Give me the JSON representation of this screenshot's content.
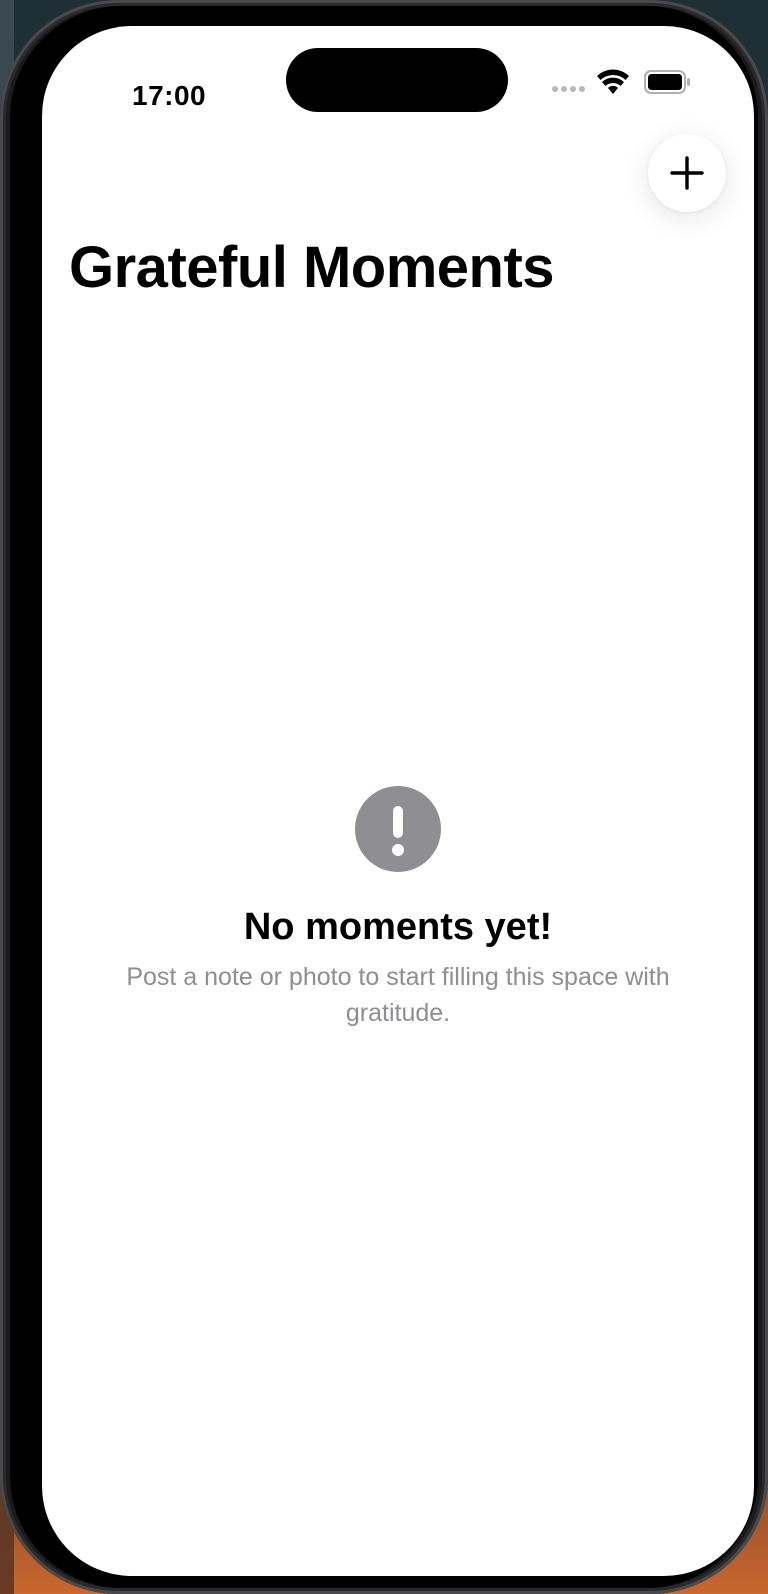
{
  "status_bar": {
    "time": "17:00",
    "signal_icon": "cellular-signal-icon",
    "wifi_icon": "wifi-icon",
    "battery_icon": "battery-icon"
  },
  "header": {
    "title": "Grateful Moments",
    "add_button_icon": "plus-icon"
  },
  "empty_state": {
    "icon": "exclamation-circle-icon",
    "title": "No moments yet!",
    "subtitle": "Post a note or photo to start filling this space with gratitude."
  },
  "colors": {
    "screen_background": "#ffffff",
    "secondary_text": "#8e8e93",
    "empty_icon_fill": "#8e8e93",
    "primary_text": "#000000"
  }
}
